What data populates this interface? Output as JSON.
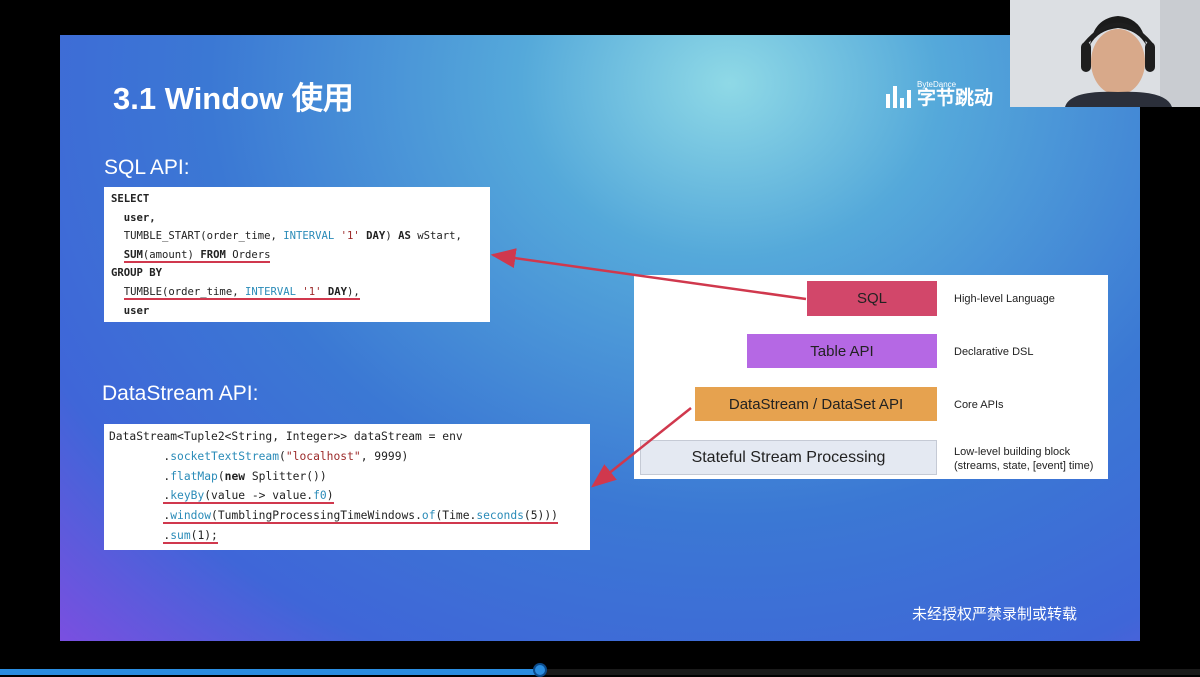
{
  "slide": {
    "title": "3.1 Window 使用",
    "logo": {
      "small": "ByteDance",
      "big": "字节跳动"
    },
    "sql_label": "SQL API:",
    "datastream_label": "DataStream API:",
    "watermark": "未经授权严禁录制或转载"
  },
  "sql_code": {
    "l1": "SELECT",
    "l2": "  user,",
    "l3_a": "  TUMBLE_START(order_time, ",
    "l3_b": "INTERVAL",
    "l3_c": " ",
    "l3_d": "'1'",
    "l3_e": " ",
    "l3_f": "DAY",
    "l3_g": ") ",
    "l3_h": "AS",
    "l3_i": " wStart,",
    "l4_a": "SUM",
    "l4_b": "(amount) ",
    "l4_c": "FROM",
    "l4_d": " Orders",
    "l5": "GROUP BY",
    "l6_a": "TUMBLE(order_time, ",
    "l6_b": "INTERVAL",
    "l6_c": " ",
    "l6_d": "'1'",
    "l6_e": " ",
    "l6_f": "DAY",
    "l6_g": "),",
    "l7": "  user"
  },
  "ds_code": {
    "l1": "DataStream<Tuple2<String, Integer>> dataStream = env",
    "l2_a": "        .",
    "l2_b": "socketTextStream",
    "l2_c": "(",
    "l2_d": "\"localhost\"",
    "l2_e": ", 9999)",
    "l3_a": "        .",
    "l3_b": "flatMap",
    "l3_c": "(",
    "l3_d": "new",
    "l3_e": " Splitter())",
    "l4_a": ".",
    "l4_b": "keyBy",
    "l4_c": "(value -> value.",
    "l4_d": "f0",
    "l4_e": ")",
    "l5_a": ".",
    "l5_b": "window",
    "l5_c": "(TumblingProcessingTimeWindows.",
    "l5_d": "of",
    "l5_e": "(Time.",
    "l5_f": "seconds",
    "l5_g": "(5)))",
    "l6_a": ".",
    "l6_b": "sum",
    "l6_c": "(1);"
  },
  "layers": [
    {
      "label": "SQL",
      "desc": "High-level Language"
    },
    {
      "label": "Table API",
      "desc": "Declarative DSL"
    },
    {
      "label": "DataStream / DataSet API",
      "desc": "Core APIs"
    },
    {
      "label": "Stateful Stream Processing",
      "desc_1": "Low-level building block",
      "desc_2": "(streams, state, [event] time)"
    }
  ],
  "colors": {
    "sql_layer": "#d2476a",
    "table_layer": "#b568e4",
    "datastream_layer": "#e6a24f",
    "stateful_layer": "#e4e9f2",
    "annotation": "#d0384d"
  },
  "webcam": {
    "description": "presenter-video"
  },
  "progress": {
    "fraction": 0.45
  }
}
